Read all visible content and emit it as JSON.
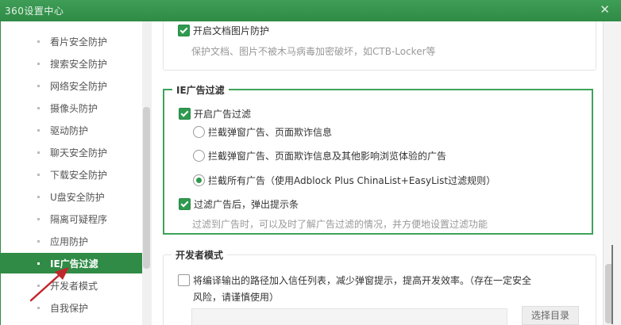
{
  "window": {
    "title": "360设置中心",
    "close_glyph": "✕"
  },
  "sidebar": {
    "items": [
      {
        "label": "看片安全防护",
        "active": false
      },
      {
        "label": "搜索安全防护",
        "active": false
      },
      {
        "label": "网络安全防护",
        "active": false
      },
      {
        "label": "摄像头防护",
        "active": false
      },
      {
        "label": "驱动防护",
        "active": false
      },
      {
        "label": "聊天安全防护",
        "active": false
      },
      {
        "label": "下载安全防护",
        "active": false
      },
      {
        "label": "U盘安全防护",
        "active": false
      },
      {
        "label": "隔离可疑程序",
        "active": false
      },
      {
        "label": "应用防护",
        "active": false
      },
      {
        "label": "IE广告过滤",
        "active": true
      },
      {
        "label": "开发者模式",
        "active": false
      },
      {
        "label": "自我保护",
        "active": false
      }
    ]
  },
  "doc_protect": {
    "checkbox_label": "开启文档图片防护",
    "checked": true,
    "description": "保护文档、图片不被木马病毒加密破坏，如CTB-Locker等"
  },
  "ie_ad_filter": {
    "legend": "IE广告过滤",
    "enable_label": "开启广告过滤",
    "enable_checked": true,
    "options": [
      {
        "label": "拦截弹窗广告、页面欺诈信息",
        "selected": false
      },
      {
        "label": "拦截弹窗广告、页面欺诈信息及其他影响浏览体验的广告",
        "selected": false
      },
      {
        "label": "拦截所有广告（使用Adblock Plus ChinaList+EasyList过滤规则）",
        "selected": true
      }
    ],
    "popup_label": "过滤广告后，弹出提示条",
    "popup_checked": true,
    "description": "过滤到广告时，可以及时了解广告过滤的情况，并方便地设置过滤功能"
  },
  "dev_mode": {
    "legend": "开发者模式",
    "checkbox_line1": "将编译输出的路径加入信任列表，减少弹窗提示，提高开发效率。（存在一定安全",
    "checkbox_line2": "风险，请谨慎使用）",
    "checked": false,
    "dir_input_value": "",
    "select_dir_button": "选择目录"
  },
  "colors": {
    "accent": "#2f8b45",
    "checkbox": "#2f9a4f",
    "annotation_arrow": "#c0282d"
  },
  "icons": [
    "close-icon",
    "checkbox-icon",
    "radio-icon",
    "annotation-arrow-icon"
  ]
}
